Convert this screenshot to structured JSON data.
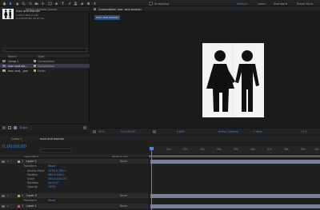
{
  "toolbar": {
    "snapping_label": "Snapping",
    "workspaces": [
      "Default",
      "Learn",
      "Standard",
      "Small Scre"
    ],
    "active_workspace": "Default"
  },
  "project_panel": {
    "tab_label": "Project",
    "effect_controls_label": "Effect Controls (none)",
    "selected_item": {
      "name": "man and woman",
      "line1": "1,276 x 899 (1.00)",
      "line2": "Δ 0;00;05;00, 29.97 fps"
    },
    "search_placeholder": "",
    "columns": [
      "Name",
      "Type"
    ],
    "items": [
      {
        "name": "Comp 1",
        "type": "Composition",
        "selected": false
      },
      {
        "name": "man and wo...",
        "type": "Composition",
        "selected": true
      },
      {
        "name": "man and_..pmi",
        "type": "Folder",
        "selected": false
      }
    ],
    "footer_bpc": "8 bpc"
  },
  "viewer": {
    "tab_label": "Composition man and woman",
    "breadcrumb": "man and woman",
    "zoom": "50%",
    "timecode": "0;00;00;00",
    "resolution": "(Half)",
    "camera": "Active Camera",
    "views": "1 View",
    "offset": "+0.0"
  },
  "timeline": {
    "tabs": [
      {
        "label": "Comp 1",
        "active": false
      },
      {
        "label": "man and woman",
        "active": true
      }
    ],
    "timecode": "0;00;00;00",
    "column_headers": {
      "source_name": "Layer Name",
      "parent": "Parent & Link"
    },
    "ruler_labels": [
      "0s",
      "01s",
      "02s",
      "03s",
      "04s",
      "05s",
      "06s",
      "07s",
      "08s",
      "09s",
      "10s"
    ],
    "layers": [
      {
        "number": "1",
        "name": "Layer 2",
        "parent": "None",
        "color": "#b7a46b",
        "properties": [
          {
            "label": "Transform",
            "value": "Reset"
          },
          {
            "label": "Anchor Point",
            "value": "1276.0,700.0"
          },
          {
            "label": "Position",
            "value": "960.0,540.0"
          },
          {
            "label": "Scale",
            "value": "100.0,100.0%"
          },
          {
            "label": "Rotation",
            "value": "0x+0.0°"
          },
          {
            "label": "Opacity",
            "value": "100%"
          }
        ]
      },
      {
        "number": "2",
        "name": "Layer 3",
        "parent": "None",
        "color": "#b7a46b",
        "properties": [
          {
            "label": "Transform",
            "value": "Reset"
          }
        ]
      },
      {
        "number": "3",
        "name": "Layer 1",
        "parent": "None",
        "color": "#b75a8a",
        "properties": []
      }
    ]
  },
  "colors": {
    "accent": "#2d8ceb",
    "canvas": "#f3f3f3",
    "panel": "#1f1f1f",
    "track_bar": "#7a7f9a"
  }
}
